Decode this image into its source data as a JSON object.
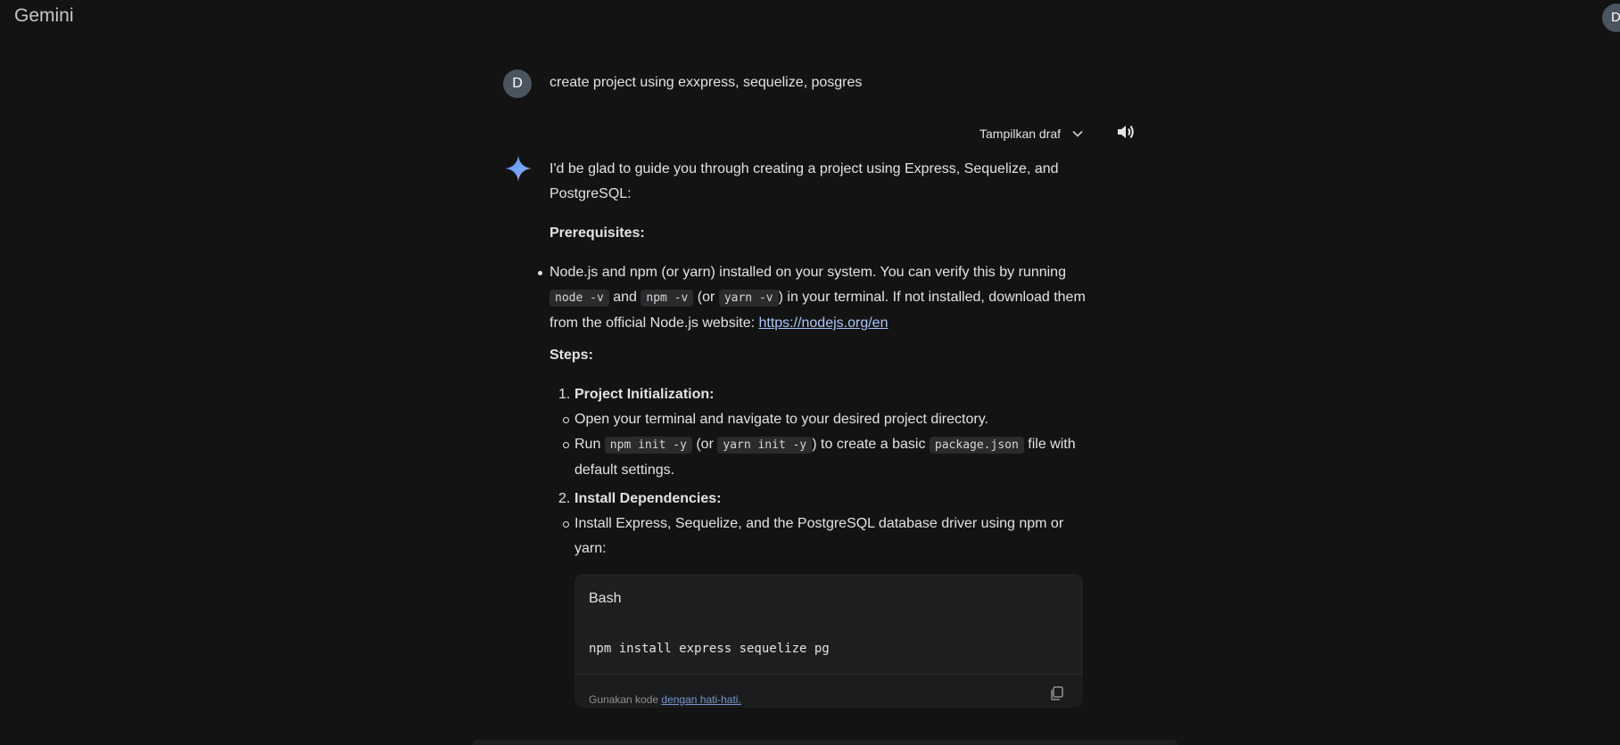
{
  "app": {
    "title": "Gemini",
    "avatar_initial": "D"
  },
  "user": {
    "avatar_initial": "D",
    "query": "create project using exxpress, sequelize, posgres"
  },
  "toolbar": {
    "drafts_label": "Tampilkan draf"
  },
  "response": {
    "intro": "I'd be glad to guide you through creating a project using Express, Sequelize, and PostgreSQL:",
    "prereq_heading": "Prerequisites:",
    "prereq": {
      "t1": "Node.js and npm (or yarn) installed on your system. You can verify this by running ",
      "c1": "node -v",
      "t2": " and ",
      "c2": "npm -v",
      "t3": " (or ",
      "c3": "yarn -v",
      "t4": ") in your terminal. If not installed, download them from the official Node.js website: ",
      "link": "https://nodejs.org/en"
    },
    "steps_heading": "Steps:",
    "step1": {
      "num": "1.",
      "title": "Project Initialization:",
      "b1": "Open your terminal and navigate to your desired project directory.",
      "b2_t1": "Run ",
      "b2_c1": "npm init -y",
      "b2_t2": " (or ",
      "b2_c2": "yarn init -y",
      "b2_t3": ") to create a basic ",
      "b2_c3": "package.json",
      "b2_t4": " file with default settings."
    },
    "step2": {
      "num": "2.",
      "title": "Install Dependencies:",
      "b1": "Install Express, Sequelize, and the PostgreSQL database driver using npm or yarn:"
    },
    "codeblock": {
      "lang": "Bash",
      "code": "npm install express sequelize pg",
      "footer_text": "Gunakan kode ",
      "footer_link": "dengan hati-hati."
    }
  }
}
